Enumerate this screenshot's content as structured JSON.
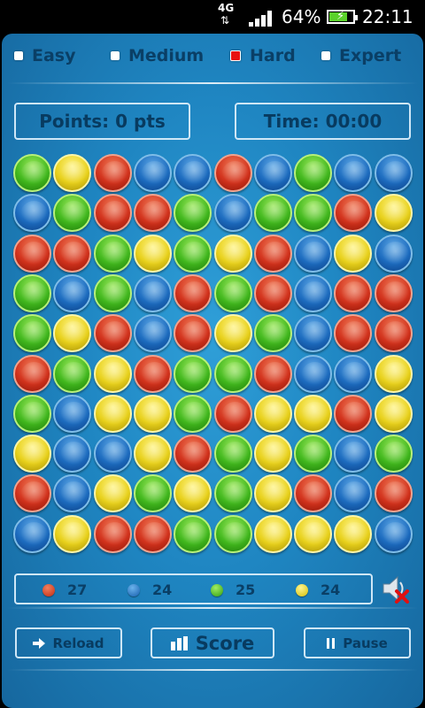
{
  "status_bar": {
    "network": "4G",
    "battery_percent": "64%",
    "time": "22:11",
    "battery_level": 0.64
  },
  "difficulty": {
    "selected": "Hard",
    "options": [
      "Easy",
      "Medium",
      "Hard",
      "Expert"
    ]
  },
  "score": {
    "points_label": "Points:",
    "points_value": "0 pts",
    "time_label": "Time:",
    "time_value": "00:00"
  },
  "board": {
    "rows": [
      [
        "green",
        "yellow",
        "red",
        "blue",
        "blue",
        "red",
        "blue",
        "green",
        "blue",
        "blue"
      ],
      [
        "blue",
        "green",
        "red",
        "red",
        "green",
        "blue",
        "green",
        "green",
        "red",
        "yellow"
      ],
      [
        "red",
        "red",
        "green",
        "yellow",
        "green",
        "yellow",
        "red",
        "blue",
        "yellow",
        "blue"
      ],
      [
        "green",
        "blue",
        "green",
        "blue",
        "red",
        "green",
        "red",
        "blue",
        "red",
        "red"
      ],
      [
        "green",
        "yellow",
        "red",
        "blue",
        "red",
        "yellow",
        "green",
        "blue",
        "red",
        "red"
      ],
      [
        "red",
        "green",
        "yellow",
        "red",
        "green",
        "green",
        "red",
        "blue",
        "blue",
        "yellow"
      ],
      [
        "green",
        "blue",
        "yellow",
        "yellow",
        "green",
        "red",
        "yellow",
        "yellow",
        "red",
        "yellow"
      ],
      [
        "yellow",
        "blue",
        "blue",
        "yellow",
        "red",
        "green",
        "yellow",
        "green",
        "blue",
        "green"
      ],
      [
        "red",
        "blue",
        "yellow",
        "green",
        "yellow",
        "green",
        "yellow",
        "red",
        "blue",
        "red"
      ],
      [
        "blue",
        "yellow",
        "red",
        "red",
        "green",
        "green",
        "yellow",
        "yellow",
        "yellow",
        "blue"
      ]
    ]
  },
  "counts": [
    {
      "color": "red",
      "value": "27"
    },
    {
      "color": "blue",
      "value": "24"
    },
    {
      "color": "green",
      "value": "25"
    },
    {
      "color": "yellow",
      "value": "24"
    }
  ],
  "sound": {
    "icon": "speaker-muted-icon",
    "muted": true
  },
  "buttons": {
    "reload": "Reload",
    "score": "Score",
    "pause": "Pause"
  },
  "colors": {
    "panel": "#1f86c2",
    "text": "#0a3f66",
    "selected_checkbox": "#e8120f"
  }
}
